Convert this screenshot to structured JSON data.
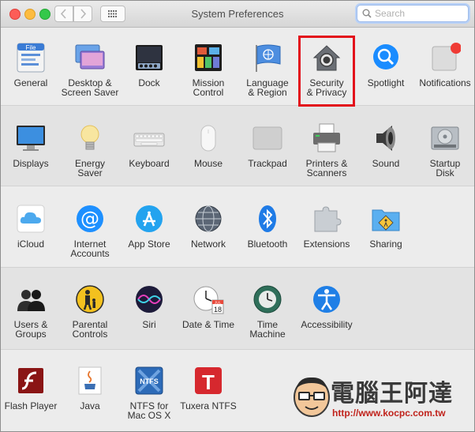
{
  "window": {
    "title": "System Preferences"
  },
  "search": {
    "placeholder": "Search"
  },
  "row1": [
    {
      "label": "General",
      "icon": "general-icon"
    },
    {
      "label": "Desktop &\nScreen Saver",
      "icon": "desktop-icon"
    },
    {
      "label": "Dock",
      "icon": "dock-icon"
    },
    {
      "label": "Mission\nControl",
      "icon": "mission-control-icon"
    },
    {
      "label": "Language\n& Region",
      "icon": "flag-icon"
    },
    {
      "label": "Security\n& Privacy",
      "icon": "house-lock-icon"
    },
    {
      "label": "Spotlight",
      "icon": "magnifier-icon"
    },
    {
      "label": "Notifications",
      "icon": "notifications-icon"
    }
  ],
  "row2": [
    {
      "label": "Displays",
      "icon": "display-icon"
    },
    {
      "label": "Energy\nSaver",
      "icon": "lightbulb-icon"
    },
    {
      "label": "Keyboard",
      "icon": "keyboard-icon"
    },
    {
      "label": "Mouse",
      "icon": "mouse-icon"
    },
    {
      "label": "Trackpad",
      "icon": "trackpad-icon"
    },
    {
      "label": "Printers &\nScanners",
      "icon": "printer-icon"
    },
    {
      "label": "Sound",
      "icon": "speaker-icon"
    },
    {
      "label": "Startup\nDisk",
      "icon": "disk-icon"
    }
  ],
  "row3": [
    {
      "label": "iCloud",
      "icon": "cloud-icon"
    },
    {
      "label": "Internet\nAccounts",
      "icon": "at-icon"
    },
    {
      "label": "App Store",
      "icon": "app-store-icon"
    },
    {
      "label": "Network",
      "icon": "globe-icon"
    },
    {
      "label": "Bluetooth",
      "icon": "bluetooth-icon"
    },
    {
      "label": "Extensions",
      "icon": "puzzle-icon"
    },
    {
      "label": "Sharing",
      "icon": "sharing-folder-icon"
    }
  ],
  "row4": [
    {
      "label": "Users &\nGroups",
      "icon": "users-icon"
    },
    {
      "label": "Parental\nControls",
      "icon": "parental-icon"
    },
    {
      "label": "Siri",
      "icon": "siri-icon"
    },
    {
      "label": "Date & Time",
      "icon": "calendar-clock-icon"
    },
    {
      "label": "Time\nMachine",
      "icon": "time-machine-icon"
    },
    {
      "label": "Accessibility",
      "icon": "accessibility-icon"
    }
  ],
  "row5": [
    {
      "label": "Flash Player",
      "icon": "flash-icon"
    },
    {
      "label": "Java",
      "icon": "java-icon"
    },
    {
      "label": "NTFS for\nMac OS X",
      "icon": "ntfs-icon"
    },
    {
      "label": "Tuxera NTFS",
      "icon": "tuxera-icon"
    }
  ],
  "icon_text": {
    "general": "File",
    "ntfs": "NTFS",
    "tuxera": "T",
    "calendar": "18",
    "calendar_month": "JUL"
  },
  "watermark": {
    "text": "電腦王阿達",
    "url": "http://www.kocpc.com.tw"
  },
  "colors": {
    "highlight": "#e3101b",
    "accent": "#1a8cff"
  }
}
